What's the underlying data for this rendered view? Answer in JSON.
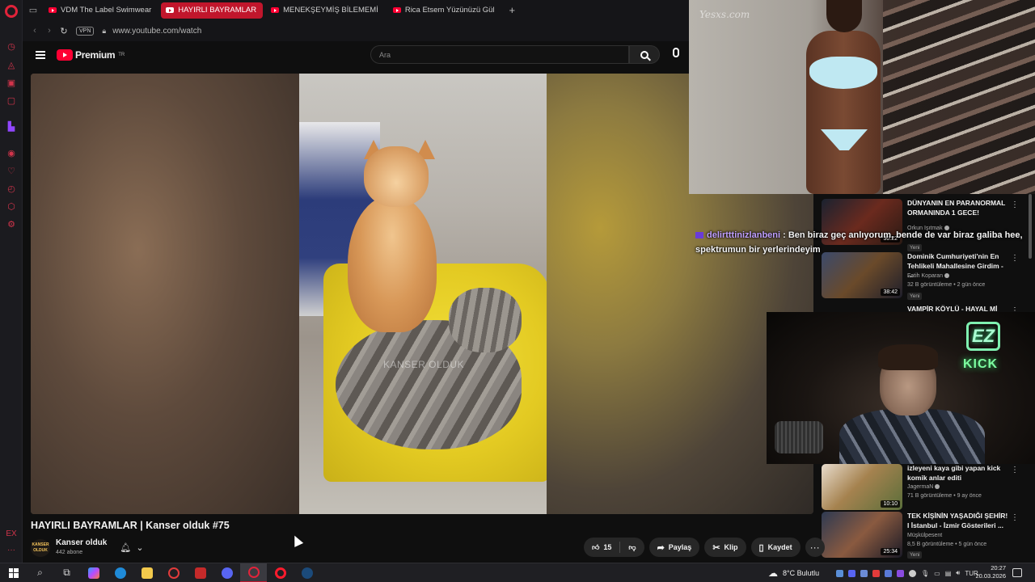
{
  "colors": {
    "opera_red": "#c1162c",
    "yt_red": "#ff0033",
    "bg": "#0f0f0f",
    "chip": "#272727",
    "kick_green": "#7dfca0",
    "chat_user": "#c0a0ff"
  },
  "sidebar": {
    "icons": [
      "opera-logo-icon",
      "history-icon",
      "messenger-icon",
      "whatsapp-icon",
      "instagram-icon",
      "twitch-icon",
      "player-icon",
      "bookmark-icon",
      "clock-icon",
      "extensions-icon",
      "settings-icon",
      "ext-icon",
      "more-icon"
    ],
    "bottom_label": "EX"
  },
  "browser": {
    "tabs": [
      {
        "label": "VDM The Label Swimwear",
        "active": false
      },
      {
        "label": "HAYIRLI BAYRAMLAR",
        "active": true
      },
      {
        "label": "MENEKŞEYMİŞ BİLEMEMİ",
        "active": false
      },
      {
        "label": "Rica Etsem Yüzünüzü Gül",
        "active": false
      }
    ],
    "new_tab": "+",
    "vpn_label": "VPN",
    "url": "www.youtube.com/watch"
  },
  "youtube": {
    "brand": "Premium",
    "brand_sup": "TR",
    "search_placeholder": "Ara"
  },
  "player": {
    "watermark": "KANSER OLDUK"
  },
  "overlays": {
    "top_watermark": "Yesxs.com",
    "chat": {
      "user": "delirtttinizlanbeni",
      "message": " : Ben biraz geç anlıyorum, bende de var biraz galiba hee, spektrumun bir yerlerindeyim"
    },
    "cam_logo": "EZ",
    "cam_kick": "KICK"
  },
  "recommendations": [
    {
      "title": "DÜNYANIN EN PARANORMAL ORMANINDA 1 GECE!",
      "channel": "Orkun Işıtmak",
      "meta": "",
      "duration": "30:22",
      "new": "Yeni"
    },
    {
      "title": "Dominik Cumhuriyeti'nin En Tehlikeli Mahallesine Girdim - ...",
      "channel": "Fatih Koparan",
      "meta": "32 B görüntüleme • 2 gün önce",
      "duration": "38:42",
      "new": "Yeni"
    },
    {
      "title": "VAMPİR KÖYLÜ - HAYAL Mİ",
      "channel": "",
      "meta": "",
      "duration": "",
      "new": ""
    },
    {
      "title": "izleyeni kaya gibi yapan kick komik anlar editi",
      "channel": "JagermaN",
      "meta": "71 B görüntüleme • 9 ay önce",
      "duration": "10:10",
      "new": ""
    },
    {
      "title": "TEK KİŞİNİN YAŞADIĞI ŞEHİR! I İstanbul - İzmir Gösterileri ...",
      "channel": "Müşkülpesent",
      "meta": "8,5 B görüntüleme • 5 gün önce",
      "duration": "25:34",
      "new": "Yeni"
    }
  ],
  "video": {
    "title": "HAYIRLI BAYRAMLAR | Kanser olduk #75",
    "channel": "Kanser olduk",
    "channel_avatar_text": "KANSER OLDUK",
    "subscribers": "442 abone",
    "likes": "15",
    "share": "Paylaş",
    "clip": "Klip",
    "save": "Kaydet"
  },
  "taskbar": {
    "weather": "8°C  Bulutlu",
    "lang": "TUR",
    "time": "20:27",
    "date": "20.03.2026"
  }
}
